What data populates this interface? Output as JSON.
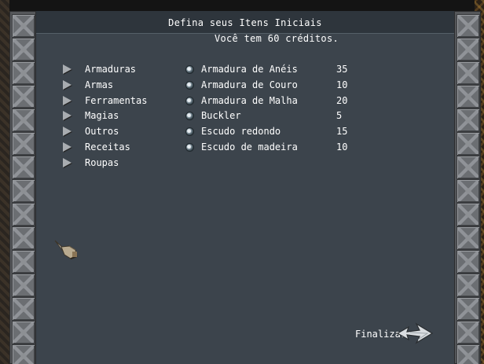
{
  "header": {
    "title": "Defina seus Itens Iniciais",
    "credits_line": "Você tem 60 créditos."
  },
  "categories": [
    {
      "label": "Armaduras"
    },
    {
      "label": "Armas"
    },
    {
      "label": "Ferramentas"
    },
    {
      "label": "Magias"
    },
    {
      "label": "Outros"
    },
    {
      "label": "Receitas"
    },
    {
      "label": "Roupas"
    }
  ],
  "items": [
    {
      "name": "Armadura de Anéis",
      "price": "35"
    },
    {
      "name": "Armadura de Couro",
      "price": "10"
    },
    {
      "name": "Armadura de Malha",
      "price": "20"
    },
    {
      "name": "Buckler",
      "price": "5"
    },
    {
      "name": "Escudo redondo",
      "price": "15"
    },
    {
      "name": "Escudo de madeira",
      "price": "10"
    }
  ],
  "footer": {
    "finish_label": "Finalizar"
  },
  "icons": {
    "category_marker": "triangle-right-icon",
    "item_marker": "radio-orb-icon",
    "cursor": "pointing-hand-icon",
    "finish": "arrow-right-icon"
  },
  "colors": {
    "panel": "#3c444c",
    "header": "#2e353c",
    "text": "#ffffff",
    "frame_stone": "#6b6e72"
  }
}
